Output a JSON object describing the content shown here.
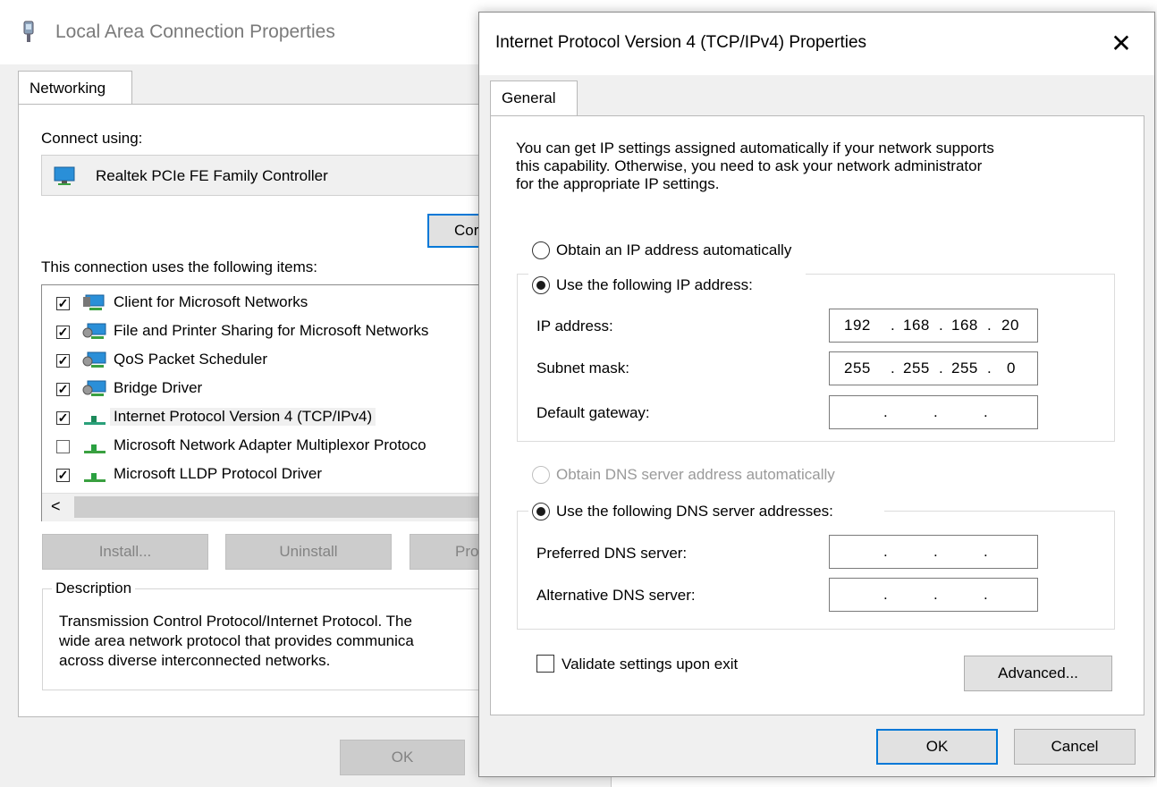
{
  "lac": {
    "title": "Local Area Connection Properties",
    "tab": "Networking",
    "connect_using_label": "Connect using:",
    "adapter": "Realtek PCIe FE Family Controller",
    "configure_label": "Cor",
    "items_label": "This connection uses the following items:",
    "items": [
      {
        "checked": true,
        "label": "Client for Microsoft Networks"
      },
      {
        "checked": true,
        "label": "File and Printer Sharing for Microsoft Networks"
      },
      {
        "checked": true,
        "label": "QoS Packet Scheduler"
      },
      {
        "checked": true,
        "label": "Bridge Driver"
      },
      {
        "checked": true,
        "label": "Internet Protocol Version 4 (TCP/IPv4)"
      },
      {
        "checked": false,
        "label": "Microsoft Network Adapter Multiplexor Protoco"
      },
      {
        "checked": true,
        "label": "Microsoft LLDP Protocol Driver"
      }
    ],
    "scroll_left": "<",
    "install_label": "Install...",
    "uninstall_label": "Uninstall",
    "properties_label": "Pro",
    "description_label": "Description",
    "description_lines": [
      "Transmission Control Protocol/Internet Protocol. The",
      "wide area network protocol that provides communica",
      "across diverse interconnected networks."
    ],
    "ok_label": "OK"
  },
  "ipv4": {
    "title": "Internet Protocol Version 4 (TCP/IPv4) Properties",
    "close": "✕",
    "tab": "General",
    "intro_lines": [
      "You can get IP settings assigned automatically if your network supports",
      "this capability. Otherwise, you need to ask your network administrator",
      "for the appropriate IP settings."
    ],
    "obtain_ip_auto": "Obtain an IP address automatically",
    "use_following_ip": "Use the following IP address:",
    "ip_address_label": "IP address:",
    "ip_address": [
      "192",
      "168",
      "168",
      "20"
    ],
    "subnet_label": "Subnet mask:",
    "subnet": [
      "255",
      "255",
      "255",
      "0"
    ],
    "gateway_label": "Default gateway:",
    "obtain_dns_auto": "Obtain DNS server address automatically",
    "use_following_dns": "Use the following DNS server addresses:",
    "preferred_dns_label": "Preferred DNS server:",
    "alternative_dns_label": "Alternative DNS server:",
    "validate_label": "Validate settings upon exit",
    "advanced_label": "Advanced...",
    "ok_label": "OK",
    "cancel_label": "Cancel"
  },
  "colors": {
    "accent": "#0078d7",
    "dialog_bg": "#f0f0f0"
  }
}
